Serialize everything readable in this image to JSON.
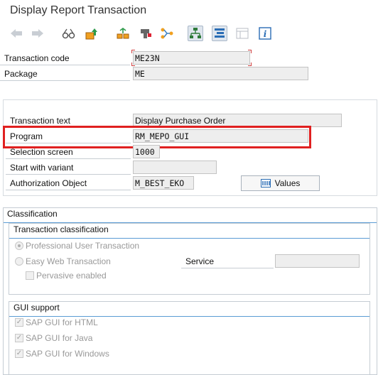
{
  "window": {
    "title": "Display Report Transaction"
  },
  "toolbar": {
    "icons": [
      "back-arrow-icon",
      "forward-arrow-icon",
      "glasses-display-icon",
      "transport-icon",
      "where-used-icon",
      "object-list-icon",
      "hierarchy-icon",
      "navigation-window-icon",
      "layout-icon",
      "info-icon"
    ]
  },
  "header": {
    "transaction_code_label": "Transaction code",
    "transaction_code_value": "ME23N",
    "package_label": "Package",
    "package_value": "ME"
  },
  "details": {
    "transaction_text_label": "Transaction text",
    "transaction_text_value": "Display Purchase Order",
    "program_label": "Program",
    "program_value": "RM_MEPO_GUI",
    "selection_screen_label": "Selection screen",
    "selection_screen_value": "1000",
    "start_variant_label": "Start with variant",
    "start_variant_value": "",
    "auth_object_label": "Authorization Object",
    "auth_object_value": "M_BEST_EKO",
    "values_button": "Values"
  },
  "classification": {
    "title": "Classification",
    "transaction_classification_title": "Transaction classification",
    "professional_label": "Professional User Transaction",
    "easy_web_label": "Easy Web Transaction",
    "service_label": "Service",
    "service_value": "",
    "pervasive_label": "Pervasive enabled"
  },
  "gui_support": {
    "title": "GUI support",
    "html_label": "SAP GUI for HTML",
    "java_label": "SAP GUI for Java",
    "windows_label": "SAP GUI for Windows"
  },
  "colors": {
    "highlight": "#e02020",
    "accent": "#5a9bd4"
  }
}
